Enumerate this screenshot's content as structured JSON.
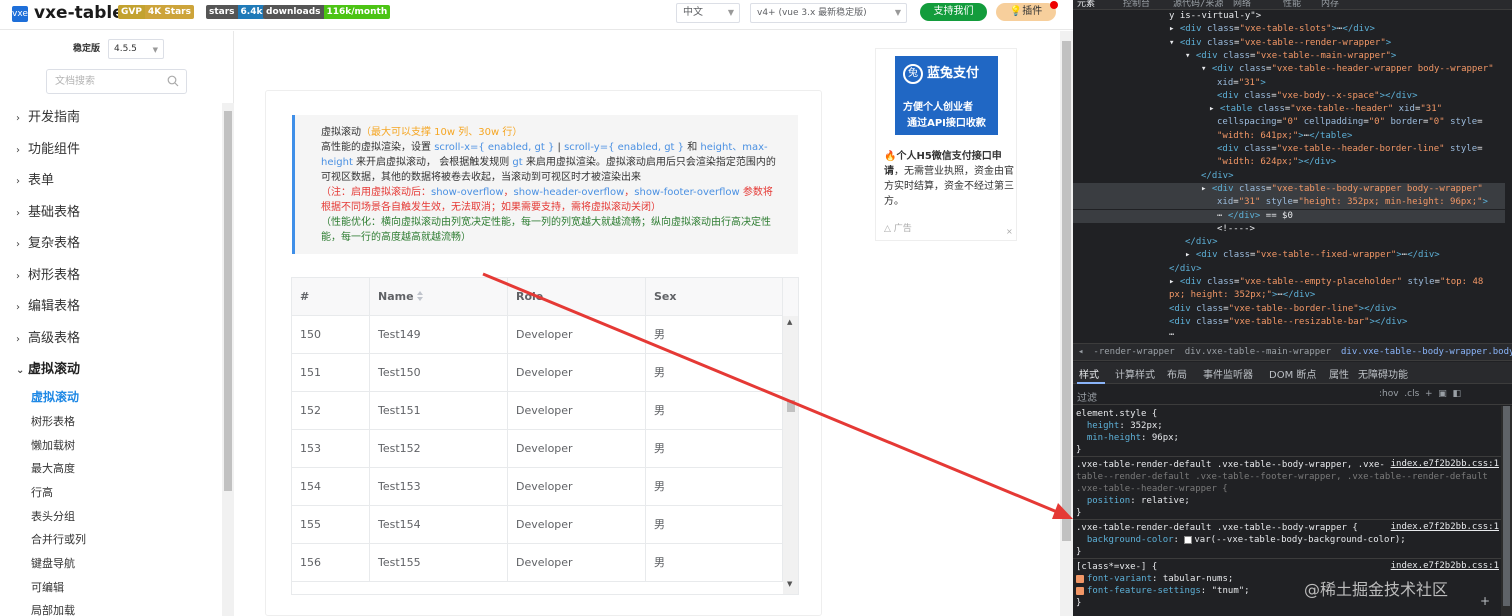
{
  "header": {
    "logo_text": "vxe-table",
    "gvp_badge": {
      "left": "GVP",
      "right": "4K Stars"
    },
    "stars_badge": {
      "left": "stars",
      "right": "6.4k"
    },
    "downloads_badge": {
      "left": "downloads",
      "right": "116k/month"
    },
    "language": "中文",
    "version_select": "v4+ (vue 3.x 最新稳定版)",
    "support_button": "支持我们",
    "plugin_button": "插件"
  },
  "sidebar": {
    "version_label": "稳定版",
    "version_value": "4.5.5",
    "search_placeholder": "文档搜索",
    "nav": [
      "开发指南",
      "功能组件",
      "表单",
      "基础表格",
      "复杂表格",
      "树形表格",
      "编辑表格",
      "高级表格",
      "虚拟滚动"
    ],
    "sub": [
      "虚拟滚动",
      "树形表格",
      "懒加载树",
      "最大高度",
      "行高",
      "表头分组",
      "合并行或列",
      "键盘导航",
      "可编辑",
      "局部加载"
    ]
  },
  "tip": {
    "title": "虚拟滚动",
    "title_hint": "（最大可以支撑 10w 列、30w 行）",
    "p1a": "高性能的虚拟渲染，设置 ",
    "p1b": "scroll-x={ enabled, gt }",
    "p1c": " | ",
    "p1d": "scroll-y={ enabled, gt }",
    "p1e": " 和 ",
    "p1f": "height、max-height",
    "p1g": " 来开启虚拟滚动， 会根据触发规则 ",
    "p1h": "gt",
    "p1i": " 来启用虚拟渲染。虚拟滚动启用后只会渲染指定范围内的可视区数据，其他的数据将被卷去收起，当滚动到可视区时才被渲染出来",
    "p2a": "（注：启用虚拟滚动后：",
    "p2b": "show-overflow",
    "p2c": "，",
    "p2d": "show-header-overflow",
    "p2e": "，",
    "p2f": "show-footer-overflow",
    "p2g": " 参数将根据不同场景各自触发生效，无法取消；如果需要支持，需将虚拟滚动关闭）",
    "p3": "（性能优化：横向虚拟滚动由列宽决定性能，每一列的列宽越大就越流畅；纵向虚拟滚动由行高决定性能，每一行的高度越高就越流畅）"
  },
  "table": {
    "columns": [
      "#",
      "Name",
      "Role",
      "Sex"
    ],
    "rows": [
      [
        "150",
        "Test149",
        "Developer",
        "男"
      ],
      [
        "151",
        "Test150",
        "Developer",
        "男"
      ],
      [
        "152",
        "Test151",
        "Developer",
        "男"
      ],
      [
        "153",
        "Test152",
        "Developer",
        "男"
      ],
      [
        "154",
        "Test153",
        "Developer",
        "男"
      ],
      [
        "155",
        "Test154",
        "Developer",
        "男"
      ],
      [
        "156",
        "Test155",
        "Developer",
        "男"
      ]
    ]
  },
  "ad": {
    "brand": "蓝兔支付",
    "logo": "兔",
    "line1": "方便个人创业者",
    "line2": "通过API接口收款",
    "text_bold": "个人H5微信支付接口申请",
    "text_rest": "，无需营业执照，资金由官方实时结算，资金不经过第三方。",
    "tag": "广告",
    "close": "×"
  },
  "devtools": {
    "tabs": [
      "元素",
      "控制台",
      "源代码/来源",
      "网络",
      "性能",
      "内存"
    ],
    "dom_lines": [
      {
        "indent": 12,
        "parts": [
          [
            "tx",
            "y is--virtual-y\">"
          ]
        ]
      },
      {
        "indent": 12,
        "parts": [
          [
            "tx",
            "▸ "
          ],
          [
            "tg",
            "<div "
          ],
          [
            "an",
            "class"
          ],
          [
            "tx",
            "="
          ],
          [
            "av",
            "\"vxe-table-slots\""
          ],
          [
            "tg",
            ">"
          ],
          [
            "tx",
            "⋯"
          ],
          [
            "tg",
            "</div>"
          ]
        ]
      },
      {
        "indent": 12,
        "parts": [
          [
            "tx",
            "▾ "
          ],
          [
            "tg",
            "<div "
          ],
          [
            "an",
            "class"
          ],
          [
            "tx",
            "="
          ],
          [
            "av",
            "\"vxe-table--render-wrapper\""
          ],
          [
            "tg",
            ">"
          ]
        ]
      },
      {
        "indent": 14,
        "parts": [
          [
            "tx",
            "▾ "
          ],
          [
            "tg",
            "<div "
          ],
          [
            "an",
            "class"
          ],
          [
            "tx",
            "="
          ],
          [
            "av",
            "\"vxe-table--main-wrapper\""
          ],
          [
            "tg",
            ">"
          ]
        ]
      },
      {
        "indent": 16,
        "parts": [
          [
            "tx",
            "▾ "
          ],
          [
            "tg",
            "<div "
          ],
          [
            "an",
            "class"
          ],
          [
            "tx",
            "="
          ],
          [
            "av",
            "\"vxe-table--header-wrapper body--wrapper\""
          ]
        ]
      },
      {
        "indent": 18,
        "parts": [
          [
            "an",
            "xid"
          ],
          [
            "tx",
            "="
          ],
          [
            "av",
            "\"31\""
          ],
          [
            "tg",
            ">"
          ]
        ]
      },
      {
        "indent": 18,
        "parts": [
          [
            "tg",
            "<div "
          ],
          [
            "an",
            "class"
          ],
          [
            "tx",
            "="
          ],
          [
            "av",
            "\"vxe-body--x-space\""
          ],
          [
            "tg",
            "></div>"
          ]
        ]
      },
      {
        "indent": 17,
        "parts": [
          [
            "tx",
            "▸ "
          ],
          [
            "tg",
            "<table "
          ],
          [
            "an",
            "class"
          ],
          [
            "tx",
            "="
          ],
          [
            "av",
            "\"vxe-table--header\""
          ],
          [
            "tx",
            " "
          ],
          [
            "an",
            "xid"
          ],
          [
            "tx",
            "="
          ],
          [
            "av",
            "\"31\""
          ]
        ]
      },
      {
        "indent": 18,
        "parts": [
          [
            "an",
            "cellspacing"
          ],
          [
            "tx",
            "="
          ],
          [
            "av",
            "\"0\""
          ],
          [
            "tx",
            " "
          ],
          [
            "an",
            "cellpadding"
          ],
          [
            "tx",
            "="
          ],
          [
            "av",
            "\"0\""
          ],
          [
            "tx",
            " "
          ],
          [
            "an",
            "border"
          ],
          [
            "tx",
            "="
          ],
          [
            "av",
            "\"0\""
          ],
          [
            "tx",
            " "
          ],
          [
            "an",
            "style"
          ],
          [
            "tx",
            "="
          ]
        ]
      },
      {
        "indent": 18,
        "parts": [
          [
            "av",
            "\"width: 641px;\""
          ],
          [
            "tg",
            ">"
          ],
          [
            "tx",
            "⋯"
          ],
          [
            "tg",
            "</table>"
          ]
        ]
      },
      {
        "indent": 18,
        "parts": [
          [
            "tg",
            "<div "
          ],
          [
            "an",
            "class"
          ],
          [
            "tx",
            "="
          ],
          [
            "av",
            "\"vxe-table--header-border-line\""
          ],
          [
            "tx",
            " "
          ],
          [
            "an",
            "style"
          ],
          [
            "tx",
            "="
          ]
        ]
      },
      {
        "indent": 18,
        "parts": [
          [
            "av",
            "\"width: 624px;\""
          ],
          [
            "tg",
            "></div>"
          ]
        ]
      },
      {
        "indent": 16,
        "parts": [
          [
            "tg",
            "</div>"
          ]
        ]
      },
      {
        "indent": 16,
        "sel": true,
        "parts": [
          [
            "tx",
            "▸ "
          ],
          [
            "tg",
            "<div "
          ],
          [
            "an",
            "class"
          ],
          [
            "tx",
            "="
          ],
          [
            "av",
            "\"vxe-table--body-wrapper body--wrapper\""
          ]
        ]
      },
      {
        "indent": 18,
        "sel": true,
        "parts": [
          [
            "an",
            "xid"
          ],
          [
            "tx",
            "="
          ],
          [
            "av",
            "\"31\""
          ],
          [
            "tx",
            " "
          ],
          [
            "an",
            "style"
          ],
          [
            "tx",
            "="
          ],
          [
            "av",
            "\"height: 352px; min-height: 96px;\""
          ],
          [
            "tg",
            ">"
          ]
        ]
      },
      {
        "indent": 18,
        "sel": true,
        "parts": [
          [
            "tx",
            "⋯ "
          ],
          [
            "tg",
            "</div>"
          ],
          [
            "tx",
            " == $0"
          ]
        ]
      },
      {
        "indent": 18,
        "parts": [
          [
            "tx",
            "<!---->"
          ]
        ]
      },
      {
        "indent": 14,
        "parts": [
          [
            "tg",
            "</div>"
          ]
        ]
      },
      {
        "indent": 14,
        "parts": [
          [
            "tx",
            "▸ "
          ],
          [
            "tg",
            "<div "
          ],
          [
            "an",
            "class"
          ],
          [
            "tx",
            "="
          ],
          [
            "av",
            "\"vxe-table--fixed-wrapper\""
          ],
          [
            "tg",
            ">"
          ],
          [
            "tx",
            "⋯"
          ],
          [
            "tg",
            "</div>"
          ]
        ]
      },
      {
        "indent": 12,
        "parts": [
          [
            "tg",
            "</div>"
          ]
        ]
      },
      {
        "indent": 12,
        "parts": [
          [
            "tx",
            "▸ "
          ],
          [
            "tg",
            "<div "
          ],
          [
            "an",
            "class"
          ],
          [
            "tx",
            "="
          ],
          [
            "av",
            "\"vxe-table--empty-placeholder\""
          ],
          [
            "tx",
            " "
          ],
          [
            "an",
            "style"
          ],
          [
            "tx",
            "="
          ],
          [
            "av",
            "\"top: 48"
          ]
        ]
      },
      {
        "indent": 12,
        "parts": [
          [
            "av",
            "px; height: 352px;\""
          ],
          [
            "tg",
            ">"
          ],
          [
            "tx",
            "⋯"
          ],
          [
            "tg",
            "</div>"
          ]
        ]
      },
      {
        "indent": 12,
        "parts": [
          [
            "tg",
            "<div "
          ],
          [
            "an",
            "class"
          ],
          [
            "tx",
            "="
          ],
          [
            "av",
            "\"vxe-table--border-line\""
          ],
          [
            "tg",
            "></div>"
          ]
        ]
      },
      {
        "indent": 12,
        "parts": [
          [
            "tg",
            "<div "
          ],
          [
            "an",
            "class"
          ],
          [
            "tx",
            "="
          ],
          [
            "av",
            "\"vxe-table--resizable-bar\""
          ],
          [
            "tg",
            "></div>"
          ]
        ]
      },
      {
        "indent": 12,
        "parts": [
          [
            "tx",
            "⋯"
          ]
        ]
      }
    ],
    "breadcrumbs": [
      "◂",
      "-render-wrapper",
      "div.vxe-table--main-wrapper",
      "div.vxe-table--body-wrapper.body--wrapper"
    ],
    "style_tabs": [
      "样式",
      "计算样式",
      "布局",
      "事件监听器",
      "DOM 断点",
      "属性",
      "无障碍功能"
    ],
    "filter_label": "过滤",
    "filter_tools": ":hov  .cls  +  ▣  ◧",
    "rules": [
      {
        "sel": "element.style {",
        "props": [
          [
            "height",
            "352px;"
          ],
          [
            "min-height",
            "96px;"
          ]
        ]
      },
      {
        "sel": ".vxe-table-render-default .vxe-table--body-wrapper, .vxe-",
        "sel2": "table--render-default .vxe-table--footer-wrapper, .vxe-table--render-default",
        "sel3": ".vxe-table--header-wrapper {",
        "src": "index.e7f2b2bb.css:1",
        "props": [
          [
            "position",
            "relative;"
          ]
        ]
      },
      {
        "sel": ".vxe-table-render-default .vxe-table--body-wrapper {",
        "src": "index.e7f2b2bb.css:1",
        "props": [
          [
            "background-color",
            "var(--vxe-table-body-background-color);"
          ]
        ]
      },
      {
        "sel": "[class*=vxe-] {",
        "src": "index.e7f2b2bb.css:1",
        "props": [
          [
            "font-variant",
            "tabular-nums;"
          ],
          [
            "font-feature-settings",
            "\"tnum\";"
          ]
        ]
      }
    ]
  },
  "watermark": "@稀土掘金技术社区"
}
